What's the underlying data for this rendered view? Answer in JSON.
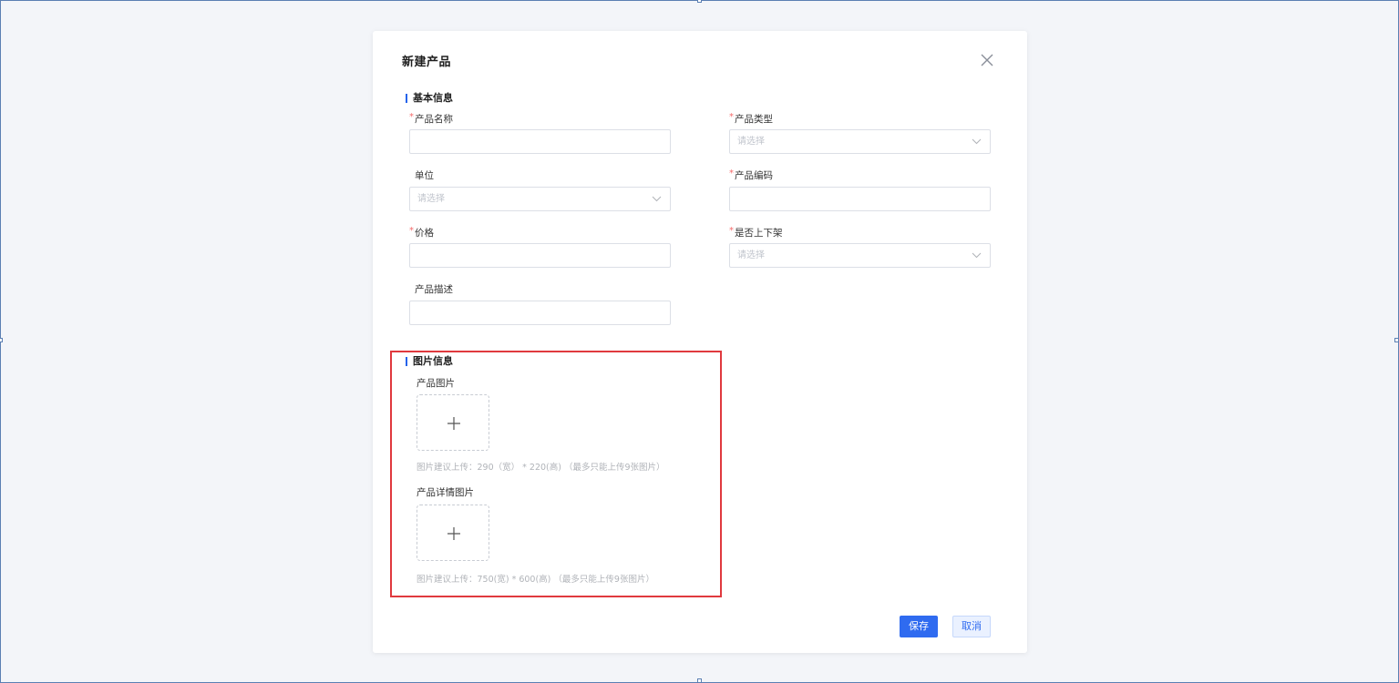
{
  "dialog": {
    "title": "新建产品",
    "sections": {
      "basic": "基本信息",
      "images": "图片信息"
    },
    "fields": {
      "product_name": {
        "label": "产品名称",
        "value": ""
      },
      "product_type": {
        "label": "产品类型",
        "placeholder": "请选择"
      },
      "unit": {
        "label": "单位",
        "placeholder": "请选择"
      },
      "product_code": {
        "label": "产品编码",
        "value": ""
      },
      "price": {
        "label": "价格",
        "value": ""
      },
      "on_shelf": {
        "label": "是否上下架",
        "placeholder": "请选择"
      },
      "description": {
        "label": "产品描述",
        "value": ""
      }
    },
    "uploads": {
      "product_image": {
        "label": "产品图片",
        "hint": "图片建议上传：290（宽） * 220(高) （最多只能上传9张图片）"
      },
      "detail_image": {
        "label": "产品详情图片",
        "hint": "图片建议上传：750(宽) * 600(高) （最多只能上传9张图片）"
      }
    },
    "buttons": {
      "save": "保存",
      "cancel": "取消"
    }
  },
  "colors": {
    "accent": "#2f6bf0",
    "required": "#f56c6c",
    "highlight_border": "#e0393e",
    "background": "#f3f5f9"
  },
  "icons": [
    "close-icon",
    "chevron-down-icon",
    "plus-icon"
  ]
}
